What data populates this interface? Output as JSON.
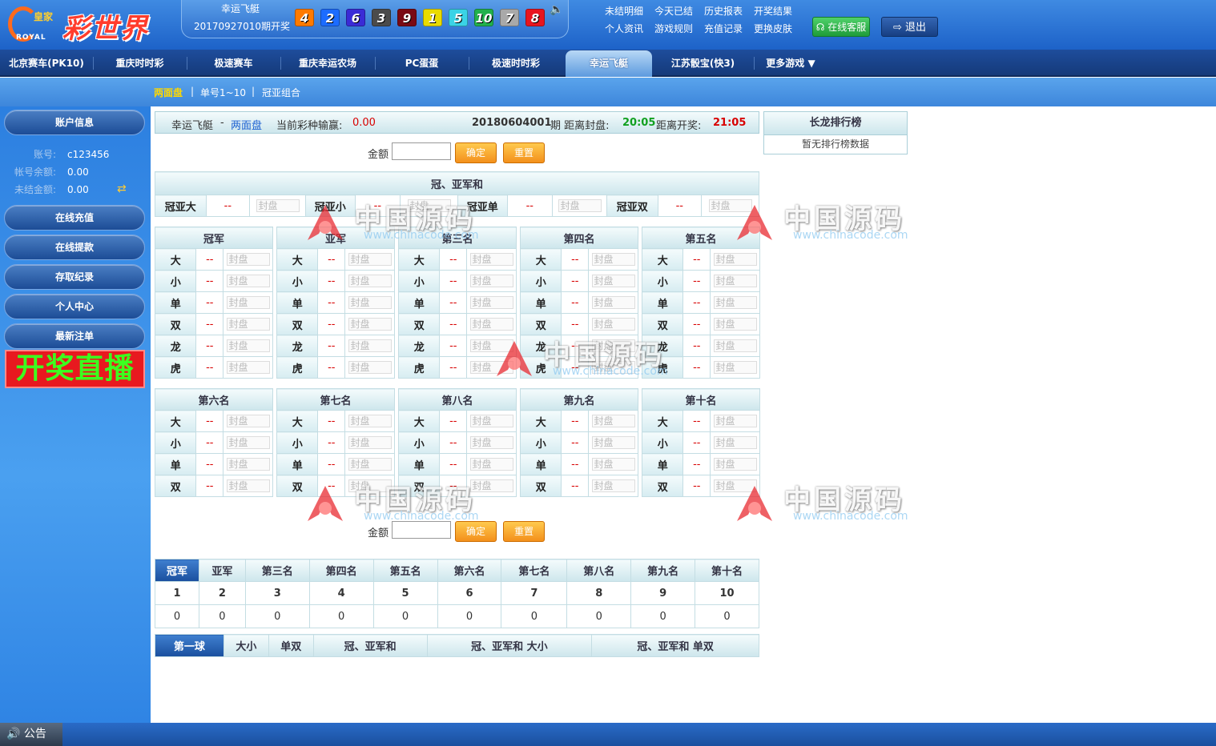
{
  "header": {
    "logo_small": "皇家",
    "logo_big": "彩世界",
    "logo_royal": "ROYAL",
    "draw_game": "幸运飞艇",
    "draw_issue": "20170927010期开奖",
    "balls": [
      {
        "n": "4",
        "color": "#ff7a00"
      },
      {
        "n": "2",
        "color": "#1c6cff"
      },
      {
        "n": "6",
        "color": "#3a2bd6"
      },
      {
        "n": "3",
        "color": "#4b4b4b"
      },
      {
        "n": "9",
        "color": "#7a0a14"
      },
      {
        "n": "1",
        "color": "#eadb00"
      },
      {
        "n": "5",
        "color": "#3ad3e6"
      },
      {
        "n": "10",
        "color": "#22b14c"
      },
      {
        "n": "7",
        "color": "#a9a9a9"
      },
      {
        "n": "8",
        "color": "#e8151f"
      }
    ],
    "links": [
      "未结明细",
      "今天已结",
      "历史报表",
      "开奖结果",
      "个人资讯",
      "游戏规则",
      "充值记录",
      "更换皮肤"
    ],
    "service_btn": "在线客服",
    "logout_btn": "退出"
  },
  "nav": {
    "items": [
      "北京赛车(PK10)",
      "重庆时时彩",
      "极速赛车",
      "重庆幸运农场",
      "PC蛋蛋",
      "极速时时彩",
      "幸运飞艇",
      "江苏骰宝(快3)",
      "更多游戏 ▼"
    ],
    "active": "幸运飞艇"
  },
  "subnav": {
    "items": [
      "两面盘",
      "单号1~10",
      "冠亚组合"
    ],
    "active": "两面盘",
    "sep": "|"
  },
  "sidebar": {
    "account_btn": "账户信息",
    "account_label": "账号:",
    "account": "c123456",
    "balance_label": "帐号余额:",
    "balance": "0.00",
    "unsettled_label": "未结金额:",
    "unsettled": "0.00",
    "buttons": [
      "在线充值",
      "在线提款",
      "存取纪录",
      "个人中心",
      "最新注单"
    ],
    "live": "开奖直播"
  },
  "info": {
    "game": "幸运飞艇",
    "dash": "-",
    "mode": "两面盘",
    "profit_label": "当前彩种输赢:",
    "profit": "0.00",
    "period": "20180604001",
    "period_suffix": "期 距离封盘:",
    "close_time": "20:05",
    "draw_label": "距离开奖:",
    "draw_time": "21:05"
  },
  "form": {
    "amount_label": "金额",
    "confirm": "确定",
    "reset": "重置"
  },
  "guanya": {
    "title": "冠、亚军和",
    "cells": [
      {
        "label": "冠亚大",
        "odds": "--"
      },
      {
        "label": "冠亚小",
        "odds": "--"
      },
      {
        "label": "冠亚单",
        "odds": "--"
      },
      {
        "label": "冠亚双",
        "odds": "--"
      }
    ],
    "sealed": "封盘"
  },
  "positions_top": [
    {
      "title": "冠军",
      "rows": [
        "大",
        "小",
        "单",
        "双",
        "龙",
        "虎"
      ]
    },
    {
      "title": "亚军",
      "rows": [
        "大",
        "小",
        "单",
        "双",
        "龙",
        "虎"
      ]
    },
    {
      "title": "第三名",
      "rows": [
        "大",
        "小",
        "单",
        "双",
        "龙",
        "虎"
      ]
    },
    {
      "title": "第四名",
      "rows": [
        "大",
        "小",
        "单",
        "双",
        "龙",
        "虎"
      ]
    },
    {
      "title": "第五名",
      "rows": [
        "大",
        "小",
        "单",
        "双",
        "龙",
        "虎"
      ]
    }
  ],
  "positions_bottom": [
    {
      "title": "第六名",
      "rows": [
        "大",
        "小",
        "单",
        "双"
      ]
    },
    {
      "title": "第七名",
      "rows": [
        "大",
        "小",
        "单",
        "双"
      ]
    },
    {
      "title": "第八名",
      "rows": [
        "大",
        "小",
        "单",
        "双"
      ]
    },
    {
      "title": "第九名",
      "rows": [
        "大",
        "小",
        "单",
        "双"
      ]
    },
    {
      "title": "第十名",
      "rows": [
        "大",
        "小",
        "单",
        "双"
      ]
    }
  ],
  "odds_placeholder": "--",
  "rank_tabs": [
    "冠军",
    "亚军",
    "第三名",
    "第四名",
    "第五名",
    "第六名",
    "第七名",
    "第八名",
    "第九名",
    "第十名"
  ],
  "stats": {
    "numbers": [
      "1",
      "2",
      "3",
      "4",
      "5",
      "6",
      "7",
      "8",
      "9",
      "10"
    ],
    "counts": [
      "0",
      "0",
      "0",
      "0",
      "0",
      "0",
      "0",
      "0",
      "0",
      "0"
    ]
  },
  "bottom_tabs": [
    "第一球",
    "大小",
    "单双",
    "冠、亚军和",
    "冠、亚军和 大小",
    "冠、亚军和 单双"
  ],
  "changlong": {
    "title": "长龙排行榜",
    "empty": "暂无排行榜数据"
  },
  "watermark": {
    "cn": "中国源码",
    "url": "www.chinacode.com"
  },
  "footer": {
    "notice": "公告"
  },
  "colors": {
    "accent": "#1d62c8",
    "odds": "#d80000",
    "live_bg": "#e8191f",
    "live_text": "#3cff1f"
  }
}
